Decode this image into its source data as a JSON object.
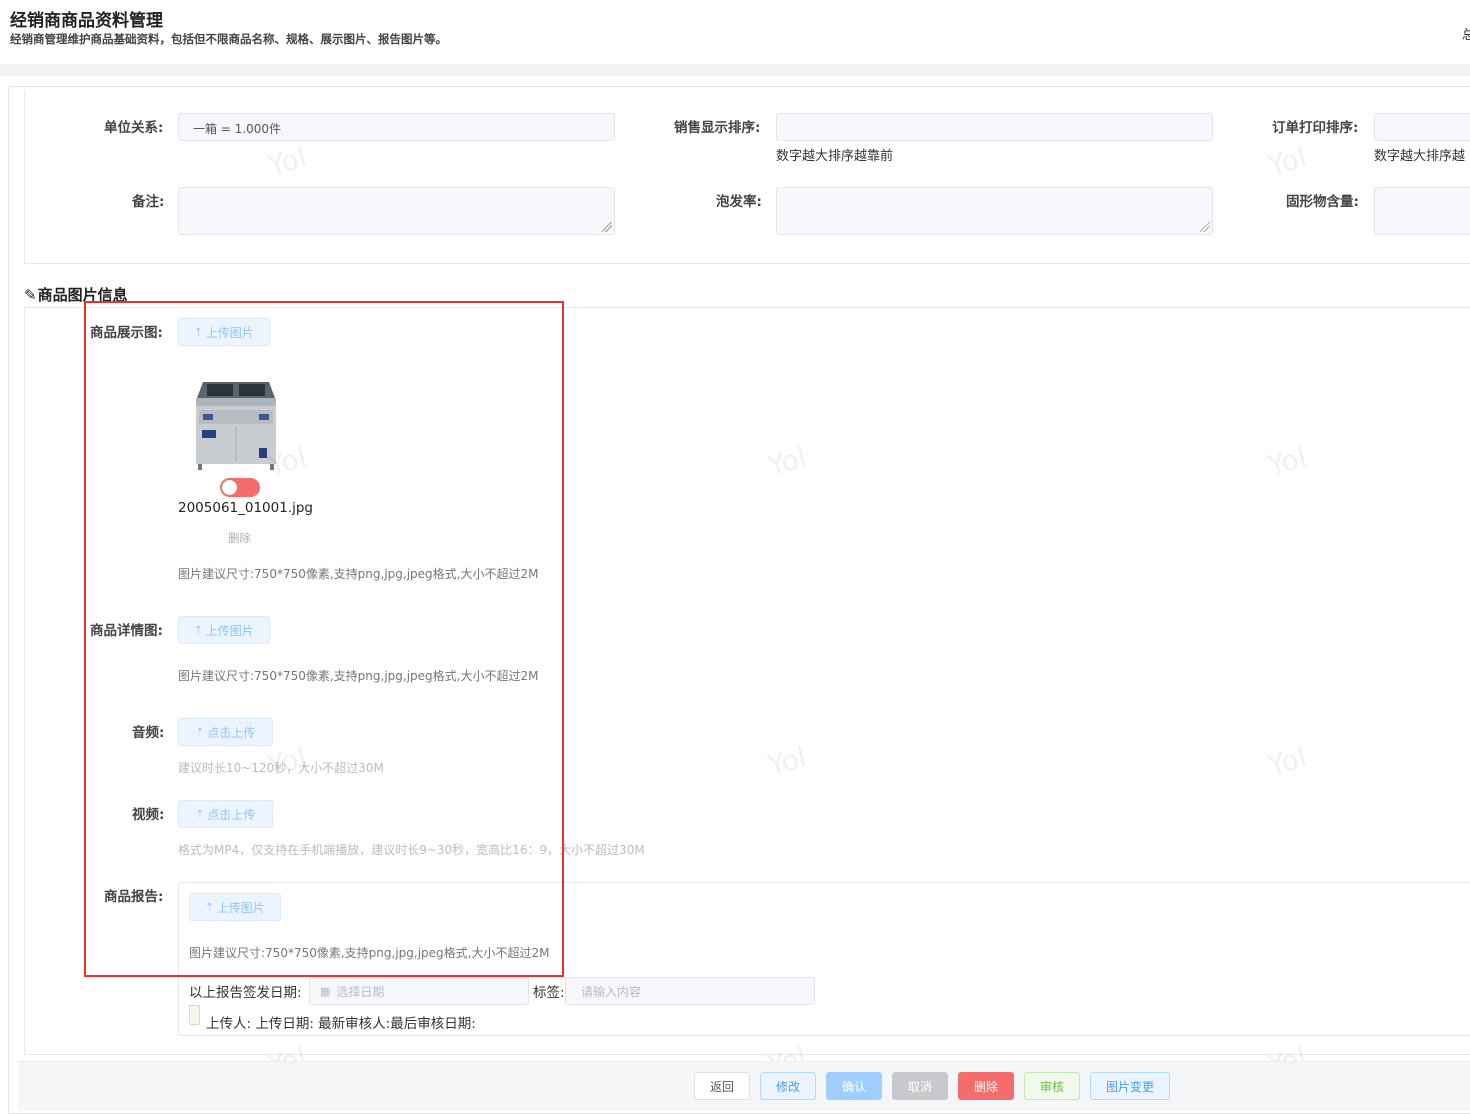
{
  "header": {
    "title": "经销商商品资料管理",
    "subtitle": "经销商管理维护商品基础资料，包括但不限商品名称、规格、展示图片、报告图片等。",
    "right_glyph": "总"
  },
  "basic_form": {
    "unit_relation": {
      "label": "单位关系:",
      "value": "一箱 = 1.000件"
    },
    "sales_display_order": {
      "label": "销售显示排序:",
      "value": "",
      "hint": "数字越大排序越靠前"
    },
    "order_print_order": {
      "label": "订单打印排序:",
      "value": "",
      "hint": "数字越大排序越"
    },
    "remark": {
      "label": "备注:",
      "value": ""
    },
    "foam_rate": {
      "label": "泡发率:",
      "value": ""
    },
    "solid_content": {
      "label": "固形物含量:",
      "value": ""
    }
  },
  "image_section": {
    "heading": "商品图片信息",
    "heading_icon": "edit-icon",
    "display_image": {
      "label": "商品展示图:",
      "upload_label": "上传图片",
      "file_name": "2005061_01001.jpg",
      "delete_label": "删除",
      "toggle_on": false,
      "hint": "图片建议尺寸:750*750像素,支持png,jpg,jpeg格式,大小不超过2M"
    },
    "detail_image": {
      "label": "商品详情图:",
      "upload_label": "上传图片",
      "hint": "图片建议尺寸:750*750像素,支持png,jpg,jpeg格式,大小不超过2M"
    },
    "audio": {
      "label": "音频:",
      "upload_label": "点击上传",
      "hint": "建议时长10~120秒，大小不超过30M"
    },
    "video": {
      "label": "视频:",
      "upload_label": "点击上传",
      "hint": "格式为MP4，仅支持在手机端播放，建议时长9~30秒，宽高比16：9，大小不超过30M"
    },
    "report": {
      "label": "商品报告:",
      "upload_label": "上传图片",
      "hint": "图片建议尺寸:750*750像素,支持png,jpg,jpeg格式,大小不超过2M",
      "issue_date_label": "以上报告签发日期:",
      "issue_date_placeholder": "选择日期",
      "tag_label": "标签:",
      "tag_placeholder": "请输入内容",
      "meta_line": "上传人: 上传日期: 最新审核人:最后审核日期:"
    }
  },
  "watermark_text": "Yol",
  "footer": {
    "back": "返回",
    "edit": "修改",
    "confirm": "确认",
    "cancel": "取消",
    "delete": "删除",
    "audit": "审核",
    "image_change": "图片变更"
  },
  "colors": {
    "highlight_border": "#e8332a",
    "primary": "#409eff",
    "danger": "#f56c6c",
    "success": "#67c23a"
  }
}
